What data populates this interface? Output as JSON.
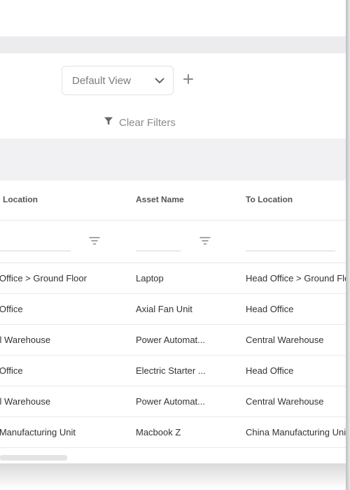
{
  "toolbar": {
    "view_select_value": "Default View",
    "add_view_label": "+",
    "clear_filters_label": "Clear Filters"
  },
  "table": {
    "columns": [
      {
        "label": "Location",
        "key": "from_location"
      },
      {
        "label": "Asset Name",
        "key": "asset_name"
      },
      {
        "label": "To Location",
        "key": "to_location"
      }
    ],
    "rows": [
      {
        "from_location": "d Office > Ground Floor",
        "asset_name": "Laptop",
        "to_location": "Head Office > Ground Flo"
      },
      {
        "from_location": "d Office",
        "asset_name": "Axial Fan Unit",
        "to_location": "Head Office"
      },
      {
        "from_location": "ral Warehouse",
        "asset_name": "Power Automat...",
        "to_location": "Central Warehouse"
      },
      {
        "from_location": "d Office",
        "asset_name": "Electric Starter ...",
        "to_location": "Head Office"
      },
      {
        "from_location": "ral Warehouse",
        "asset_name": "Power Automat...",
        "to_location": "Central Warehouse"
      },
      {
        "from_location": "a Manufacturing Unit",
        "asset_name": "Macbook Z",
        "to_location": "China Manufacturing Uni"
      }
    ]
  },
  "icons": {
    "chevron": "chevron-down-icon",
    "plus": "plus-icon",
    "filter": "funnel-icon",
    "column_filter": "filter-lines-icon"
  },
  "colors": {
    "band": "#ececef",
    "header_band": "#f1f1f3",
    "muted_text": "#8b8b8b"
  }
}
